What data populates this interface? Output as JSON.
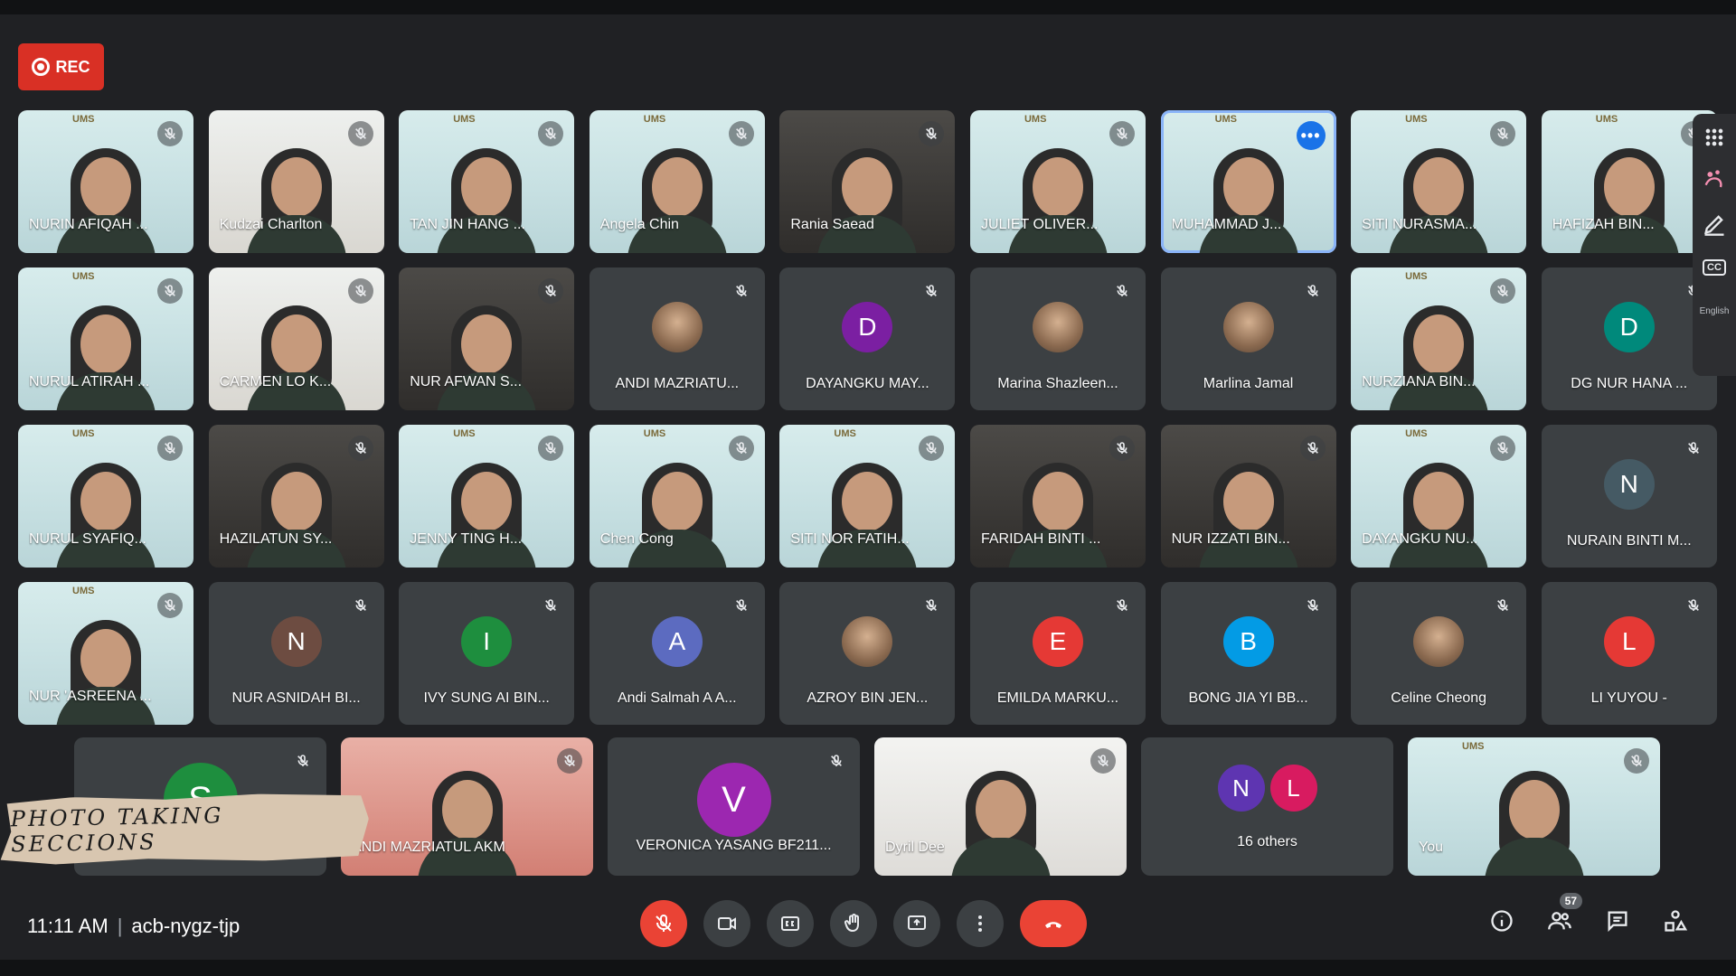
{
  "recording": {
    "label": "REC"
  },
  "grid_tiles": [
    {
      "name": "NURIN AFIQAH ...",
      "kind": "video",
      "logo": "UMS"
    },
    {
      "name": "Kudzai Charlton",
      "kind": "video",
      "variant": "warm"
    },
    {
      "name": "TAN JIN HANG ...",
      "kind": "video",
      "logo": "UMS"
    },
    {
      "name": "Angela Chin",
      "kind": "video",
      "logo": "UMS"
    },
    {
      "name": "Rania Saead",
      "kind": "video",
      "variant": "dark"
    },
    {
      "name": "JULIET OLIVER...",
      "kind": "video",
      "logo": "UMS"
    },
    {
      "name": "MUHAMMAD J...",
      "kind": "video",
      "logo": "UMS",
      "selected": true
    },
    {
      "name": "SITI NURASMA...",
      "kind": "video",
      "logo": "UMS"
    },
    {
      "name": "HAFIZAH BIN...",
      "kind": "video",
      "logo": "UMS"
    },
    {
      "name": "NURUL ATIRAH ...",
      "kind": "video",
      "logo": "UMS"
    },
    {
      "name": "CARMEN LO K...",
      "kind": "video",
      "variant": "warm"
    },
    {
      "name": "NUR AFWAN S...",
      "kind": "video",
      "variant": "dark"
    },
    {
      "name": "ANDI MAZRIATU...",
      "kind": "photo"
    },
    {
      "name": "DAYANGKU MAY...",
      "kind": "letter",
      "letter": "D",
      "color": "#7b1fa2"
    },
    {
      "name": "Marina Shazleen...",
      "kind": "photo"
    },
    {
      "name": "Marlina Jamal",
      "kind": "photo"
    },
    {
      "name": "NURZIANA BIN...",
      "kind": "video",
      "logo": "UMS"
    },
    {
      "name": "DG NUR HANA ...",
      "kind": "letter",
      "letter": "D",
      "color": "#00897b"
    },
    {
      "name": "NURUL SYAFIQ...",
      "kind": "video",
      "logo": "UMS"
    },
    {
      "name": "HAZILATUN SY...",
      "kind": "video",
      "variant": "dark"
    },
    {
      "name": "JENNY TING H...",
      "kind": "video",
      "logo": "UMS"
    },
    {
      "name": "Chen Cong",
      "kind": "video",
      "logo": "UMS"
    },
    {
      "name": "SITI NOR FATIH...",
      "kind": "video",
      "logo": "UMS"
    },
    {
      "name": "FARIDAH BINTI ...",
      "kind": "video",
      "variant": "dark"
    },
    {
      "name": "NUR IZZATI BIN...",
      "kind": "video",
      "variant": "dark"
    },
    {
      "name": "DAYANGKU NU...",
      "kind": "video",
      "logo": "UMS"
    },
    {
      "name": "NURAIN BINTI M...",
      "kind": "letter",
      "letter": "N",
      "color": "#455a64"
    },
    {
      "name": "NUR 'ASREENA ...",
      "kind": "video",
      "logo": "UMS"
    },
    {
      "name": "NUR ASNIDAH BI...",
      "kind": "letter",
      "letter": "N",
      "color": "#6d4c41"
    },
    {
      "name": "IVY SUNG AI BIN...",
      "kind": "letter",
      "letter": "I",
      "color": "#1e8e3e"
    },
    {
      "name": "Andi Salmah A A...",
      "kind": "letter",
      "letter": "A",
      "color": "#5c6bc0"
    },
    {
      "name": "AZROY BIN JEN...",
      "kind": "photo"
    },
    {
      "name": "EMILDA MARKU...",
      "kind": "letter",
      "letter": "E",
      "color": "#e53935"
    },
    {
      "name": "BONG JIA YI BB...",
      "kind": "letter",
      "letter": "B",
      "color": "#039be5"
    },
    {
      "name": "Celine Cheong",
      "kind": "photo"
    },
    {
      "name": "LI YUYOU -",
      "kind": "letter",
      "letter": "L",
      "color": "#e53935"
    }
  ],
  "bottom_tiles": [
    {
      "name": "",
      "kind": "letter",
      "letter": "S",
      "color": "#1e8e3e"
    },
    {
      "name": "ANDI MAZRIATUL AKMA ...",
      "kind": "video",
      "variant": "pink"
    },
    {
      "name": "VERONICA YASANG BF211...",
      "kind": "letter",
      "letter": "V",
      "color": "#9c27b0"
    },
    {
      "name": "Dyril Dee",
      "kind": "video",
      "variant": "white"
    },
    {
      "name": "16 others",
      "kind": "others",
      "letters": [
        "N",
        "L"
      ],
      "colors": [
        "#5e35b1",
        "#d81b60"
      ]
    },
    {
      "name": "You",
      "kind": "video",
      "logo": "UMS"
    }
  ],
  "banner": {
    "text": "PHOTO  TAKING  SECCIONS"
  },
  "side_panel": {
    "cc_label": "CC",
    "lang_label": "English"
  },
  "meeting": {
    "time": "11:11 AM",
    "separator": "|",
    "code": "acb-nygz-tjp"
  },
  "people_count": "57",
  "colors": {
    "end_call": "#ea4335",
    "mic_off": "#ea4335",
    "selected_outline": "#8ab4f8"
  }
}
